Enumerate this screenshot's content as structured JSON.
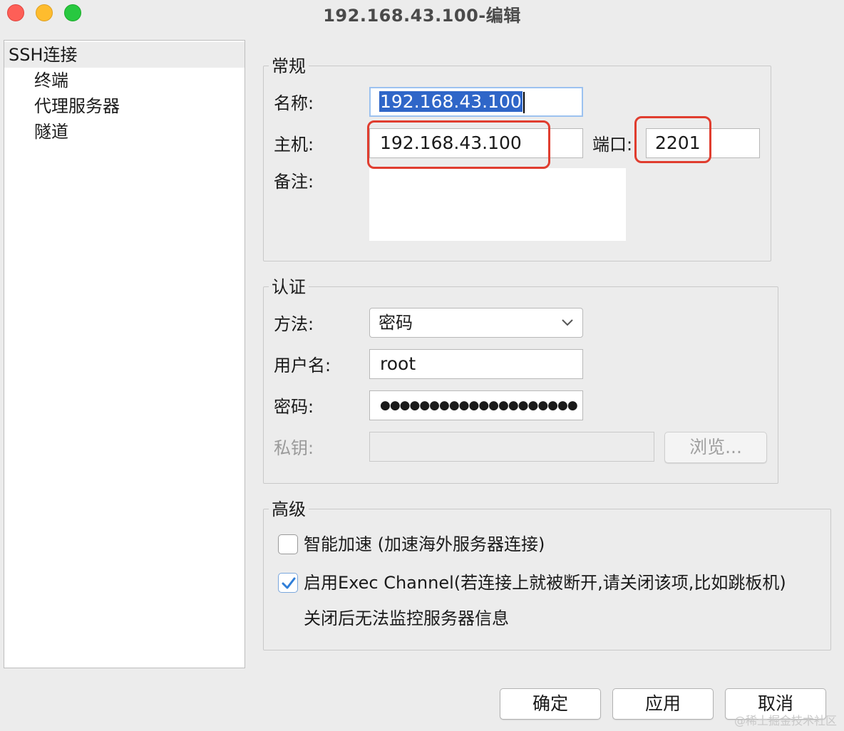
{
  "window": {
    "title": "192.168.43.100-编辑"
  },
  "sidebar": {
    "root": "SSH连接",
    "items": [
      "终端",
      "代理服务器",
      "隧道"
    ]
  },
  "general": {
    "legend": "常规",
    "name_label": "名称:",
    "name_value": "192.168.43.100",
    "host_label": "主机:",
    "host_value": "192.168.43.100",
    "port_label": "端口:",
    "port_value": "2201",
    "notes_label": "备注:",
    "notes_value": ""
  },
  "auth": {
    "legend": "认证",
    "method_label": "方法:",
    "method_value": "密码",
    "user_label": "用户名:",
    "user_value": "root",
    "password_label": "密码:",
    "password_value": "●●●●●●●●●●●●●●●●●●●●",
    "key_label": "私钥:",
    "key_value": "",
    "browse_label": "浏览..."
  },
  "advanced": {
    "legend": "高级",
    "accel_label": "智能加速 (加速海外服务器连接)",
    "accel_checked": false,
    "exec_label": "启用Exec Channel(若连接上就被断开,请关闭该项,比如跳板机)",
    "exec_checked": true,
    "exec_note": "关闭后无法监控服务器信息"
  },
  "footer": {
    "ok_label": "确定",
    "apply_label": "应用",
    "cancel_label": "取消"
  },
  "watermark": "@稀土掘金技术社区",
  "colors": {
    "selection": "#2f66c8",
    "highlight_box": "#e03d2f",
    "check_accent": "#2f7ed8"
  }
}
